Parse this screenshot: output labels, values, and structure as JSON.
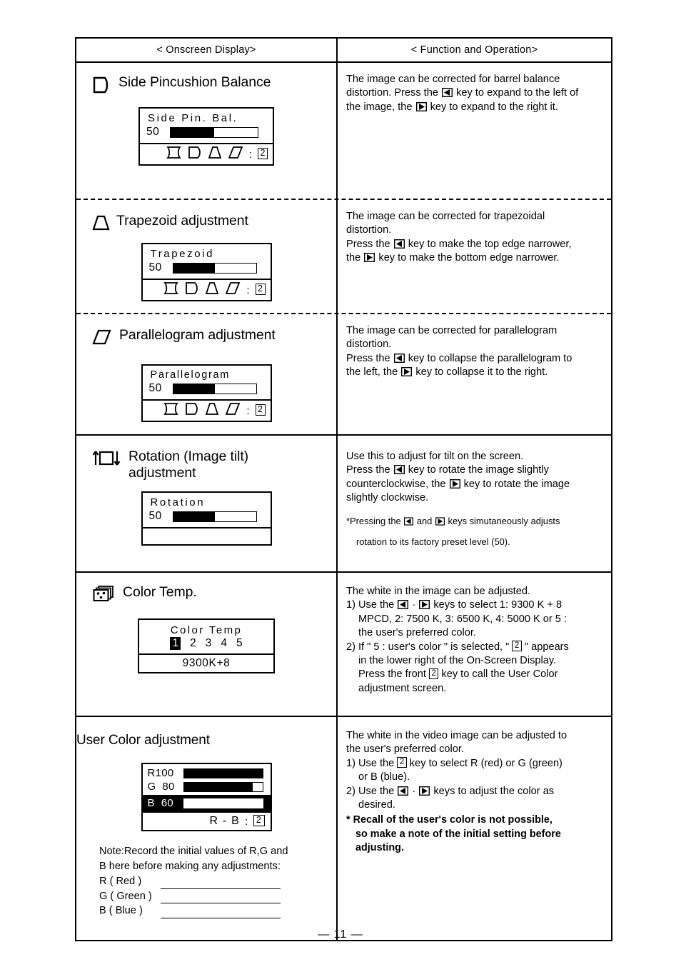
{
  "page": {
    "number": "— 11 —"
  },
  "table": {
    "header": {
      "left": "< Onscreen Display>",
      "right": "< Function and Operation>"
    }
  },
  "rows": [
    {
      "id": "side-pincushion-balance",
      "icon": "side-pincushion-icon",
      "title": "Side Pincushion Balance",
      "osd": {
        "title": "Side Pin. Bal.",
        "value": "50",
        "bar_percent": 50,
        "footer_shapes": [
          "pincushion-icon",
          "side-pincushion-icon",
          "trapezoid-icon",
          "parallelogram-icon"
        ],
        "footer_colon": ":",
        "footer_key": "2"
      },
      "text_lines": [
        "The image can be corrected for barrel balance",
        "distortion. Press the ◀ key to expand to the left of",
        "the image, the ▶ key to expand to the right it."
      ]
    },
    {
      "id": "trapezoid-adjustment",
      "icon": "trapezoid-icon",
      "title": "Trapezoid adjustment",
      "osd": {
        "title": "Trapezoid",
        "value": "50",
        "bar_percent": 50,
        "footer_shapes": [
          "pincushion-icon",
          "side-pincushion-icon",
          "trapezoid-icon",
          "parallelogram-icon"
        ],
        "footer_colon": ":",
        "footer_key": "2"
      },
      "text_lines": [
        "The image can be corrected for trapezoidal",
        "distortion.",
        "Press the ◀ key to make the top edge narrower,",
        "the ▶ key to make the bottom edge narrower."
      ]
    },
    {
      "id": "parallelogram-adjustment",
      "icon": "parallelogram-icon",
      "title": "Parallelogram adjustment",
      "osd": {
        "title": "Parallelogram",
        "value": "50",
        "bar_percent": 50,
        "footer_shapes": [
          "pincushion-icon",
          "side-pincushion-icon",
          "trapezoid-icon",
          "parallelogram-icon"
        ],
        "footer_colon": ":",
        "footer_key": "2"
      },
      "text_lines": [
        "The image can be corrected for parallelogram",
        "distortion.",
        "Press the ◀ key to collapse the parallelogram to",
        "the left, the ▶ key to collapse it to the right."
      ]
    },
    {
      "id": "rotation-adjustment",
      "icon": "rotation-icon",
      "title_line1": "Rotation (Image tilt)",
      "title_line2": "adjustment",
      "osd": {
        "title": "Rotation",
        "value": "50",
        "bar_percent": 50,
        "footer_empty": true
      },
      "text_lines": [
        "Use this to adjust for tilt on the screen.",
        "Press the ◀ key to rotate the image slightly",
        "counterclockwise, the ▶ key to rotate the image",
        "slightly clockwise."
      ],
      "note_lines": [
        "*Pressing the ◀ and ▶ keys simutaneously adjusts",
        "rotation to its factory preset level (50)."
      ]
    },
    {
      "id": "color-temp",
      "icon": "color-temp-icon",
      "title": "Color Temp.",
      "osd": {
        "title": "Color Temp",
        "options": [
          "1",
          "2",
          "3",
          "4",
          "5"
        ],
        "selected_index": 0,
        "footer_value": "9300K+8"
      },
      "intro": "The white in the image can be adjusted.",
      "items": [
        {
          "marker": "1)",
          "lines": [
            "Use the ◀ · ▶ keys to select 1: 9300 K + 8",
            "MPCD, 2: 7500 K, 3: 6500 K, 4: 5000 K or 5 :",
            "the user's preferred color."
          ]
        },
        {
          "marker": "2)",
          "lines": [
            "If \" 5 : user's color \" is selected, \" 2 \" appears",
            "in the lower right of the On-Screen Display.",
            "Press the front 2 key to call the User Color",
            "adjustment screen."
          ]
        }
      ]
    },
    {
      "id": "user-color-adjustment",
      "title": "User Color adjustment",
      "osd": {
        "channels": [
          {
            "label": "R100",
            "bar_percent": 100,
            "inverted": false
          },
          {
            "label": "G  80",
            "bar_percent": 88,
            "inverted": false
          },
          {
            "label": "B  60",
            "bar_percent": 66,
            "inverted": true
          }
        ],
        "footer_label": "R - B",
        "footer_colon": ":",
        "footer_key": "2"
      },
      "note": {
        "lines": [
          "Note:Record the initial values of R,G and",
          "B here before making any adjustments:"
        ],
        "fields": [
          "R ( Red )",
          "G ( Green )",
          "B ( Blue )"
        ]
      },
      "intro_lines": [
        "The white in the video image can be adjusted to",
        "the user's preferred color."
      ],
      "items": [
        {
          "marker": "1)",
          "lines": [
            "Use the 2 key to select R (red) or G (green)",
            "or B (blue)."
          ]
        },
        {
          "marker": "2)",
          "lines": [
            "Use the ◀ · ▶ keys to adjust the color as",
            "desired."
          ]
        }
      ],
      "warning_lines": [
        "* Recall of the user's color is not possible,",
        "so make a note of the initial setting before",
        "adjusting."
      ]
    }
  ],
  "colors": {
    "ink": "#000000",
    "paper": "#ffffff"
  }
}
